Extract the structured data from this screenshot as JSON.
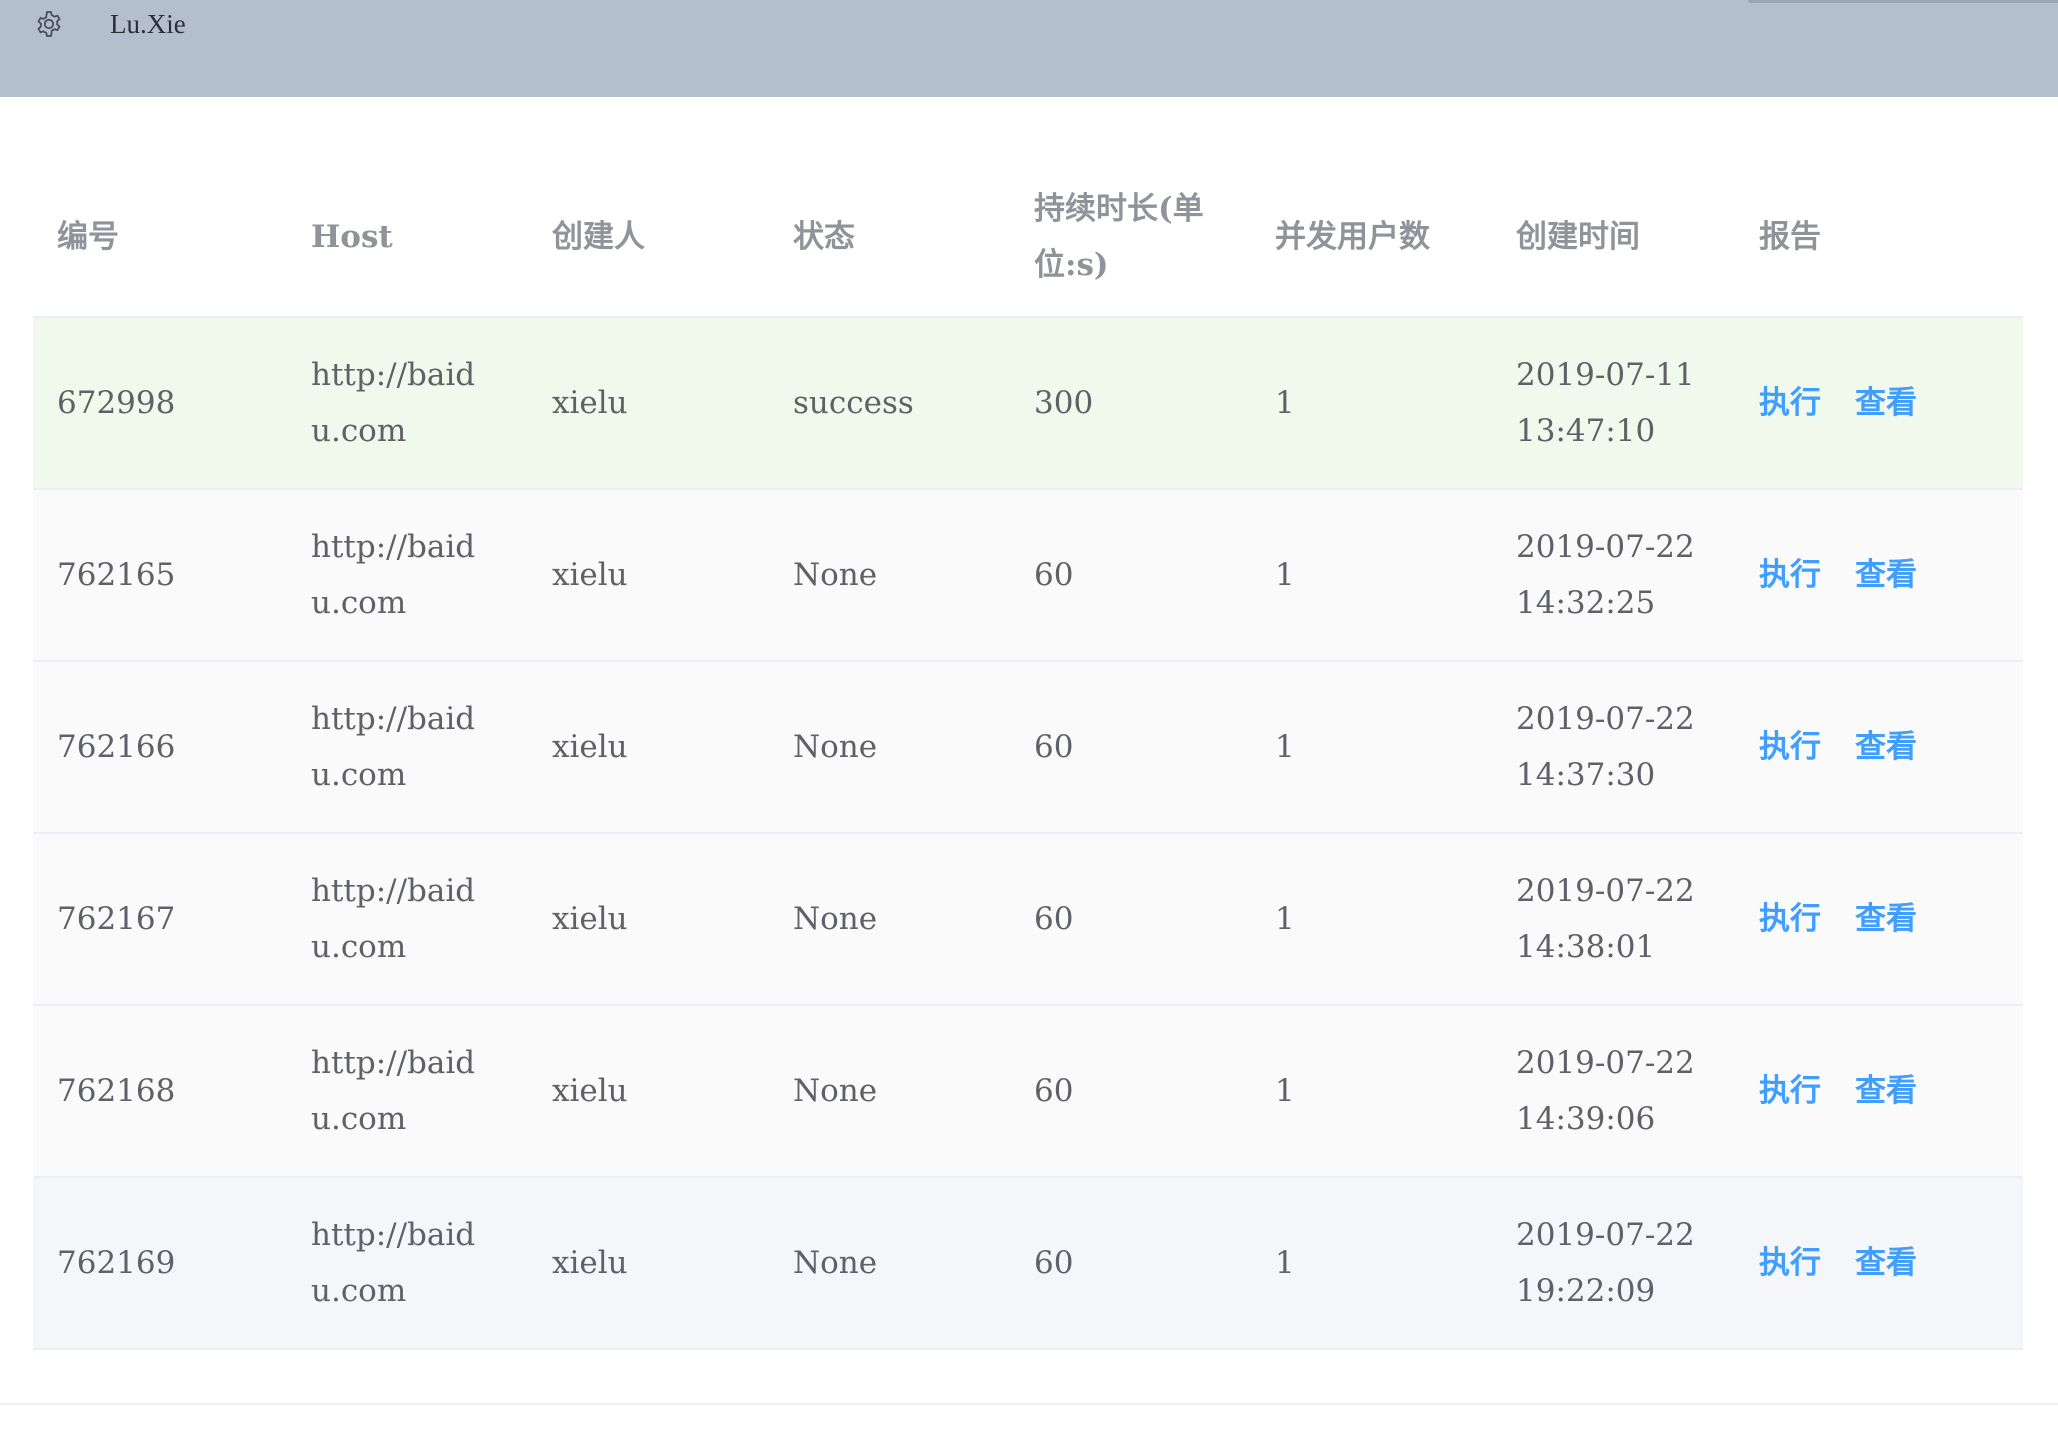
{
  "header": {
    "username": "Lu.Xie",
    "settings_icon": "gear-icon"
  },
  "table": {
    "columns": [
      "编号",
      "Host",
      "创建人",
      "状态",
      "持续时长(单位:s)",
      "并发用户数",
      "创建时间",
      "报告"
    ],
    "rows": [
      {
        "id": "672998",
        "host": "http://baidu.com",
        "creator": "xielu",
        "status": "success",
        "duration": "300",
        "users": "1",
        "created": "2019-07-11 13:47:10",
        "run": "执行",
        "view": "查看"
      },
      {
        "id": "762165",
        "host": "http://baidu.com",
        "creator": "xielu",
        "status": "None",
        "duration": "60",
        "users": "1",
        "created": "2019-07-22 14:32:25",
        "run": "执行",
        "view": "查看"
      },
      {
        "id": "762166",
        "host": "http://baidu.com",
        "creator": "xielu",
        "status": "None",
        "duration": "60",
        "users": "1",
        "created": "2019-07-22 14:37:30",
        "run": "执行",
        "view": "查看"
      },
      {
        "id": "762167",
        "host": "http://baidu.com",
        "creator": "xielu",
        "status": "None",
        "duration": "60",
        "users": "1",
        "created": "2019-07-22 14:38:01",
        "run": "执行",
        "view": "查看"
      },
      {
        "id": "762168",
        "host": "http://baidu.com",
        "creator": "xielu",
        "status": "None",
        "duration": "60",
        "users": "1",
        "created": "2019-07-22 14:39:06",
        "run": "执行",
        "view": "查看"
      },
      {
        "id": "762169",
        "host": "http://baidu.com",
        "creator": "xielu",
        "status": "None",
        "duration": "60",
        "users": "1",
        "created": "2019-07-22 19:22:09",
        "run": "执行",
        "view": "查看"
      }
    ]
  },
  "colors": {
    "header_bg": "#b3bfcd",
    "success_row": "#f0f9eb",
    "link": "#409eff"
  }
}
